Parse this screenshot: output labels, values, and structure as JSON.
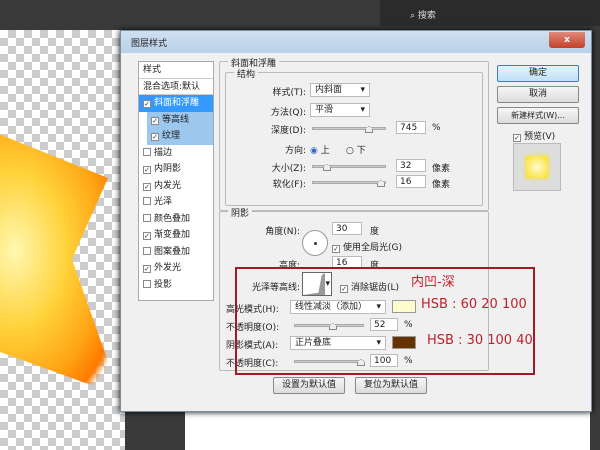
{
  "app_top": {
    "search_text": "搜索"
  },
  "dialog": {
    "title": "图层样式",
    "close": "x"
  },
  "styles": {
    "header": "样式",
    "blend": "混合选项:默认",
    "items": [
      {
        "label": "斜面和浮雕",
        "checked": true,
        "selected": true
      },
      {
        "label": "等高线",
        "checked": true,
        "sub": true
      },
      {
        "label": "纹理",
        "checked": true,
        "sub": true
      },
      {
        "label": "描边",
        "checked": false
      },
      {
        "label": "内阴影",
        "checked": true
      },
      {
        "label": "内发光",
        "checked": true
      },
      {
        "label": "光泽",
        "checked": false
      },
      {
        "label": "颜色叠加",
        "checked": false
      },
      {
        "label": "渐变叠加",
        "checked": true
      },
      {
        "label": "图案叠加",
        "checked": false
      },
      {
        "label": "外发光",
        "checked": true
      },
      {
        "label": "投影",
        "checked": false
      }
    ]
  },
  "bevel": {
    "title": "斜面和浮雕",
    "structure": "结构",
    "style_label": "样式(T):",
    "style_value": "内斜面",
    "technique_label": "方法(Q):",
    "technique_value": "平滑",
    "depth_label": "深度(D):",
    "depth_value": "745",
    "depth_unit": "%",
    "direction_label": "方向:",
    "dir_up": "上",
    "dir_down": "下",
    "size_label": "大小(Z):",
    "size_value": "32",
    "size_unit": "像素",
    "soften_label": "软化(F):",
    "soften_value": "16",
    "soften_unit": "像素"
  },
  "shading": {
    "title": "阴影",
    "angle_label": "角度(N):",
    "angle_value": "30",
    "angle_unit": "度",
    "global_light": "使用全局光(G)",
    "altitude_label": "高度:",
    "altitude_value": "16",
    "altitude_unit": "度",
    "gloss_label": "光泽等高线:",
    "antialias": "消除锯齿(L)",
    "highlight_label": "高光模式(H):",
    "highlight_value": "线性减淡（添加）",
    "highlight_color": "#fffccc",
    "hl_opacity_label": "不透明度(O):",
    "hl_opacity_value": "52",
    "pct": "%",
    "shadow_label": "阴影模式(A):",
    "shadow_value": "正片叠底",
    "shadow_color": "#663300",
    "sh_opacity_label": "不透明度(C):",
    "sh_opacity_value": "100"
  },
  "annotations": {
    "contour": "内凹-深",
    "hl_hsb": "HSB : 60 20 100",
    "sh_hsb": "HSB : 30 100 40",
    "color": "#a01c24"
  },
  "buttons": {
    "ok": "确定",
    "cancel": "取消",
    "new_style": "新建样式(W)...",
    "preview": "预览(V)",
    "make_default": "设置为默认值",
    "reset_default": "复位为默认值"
  }
}
